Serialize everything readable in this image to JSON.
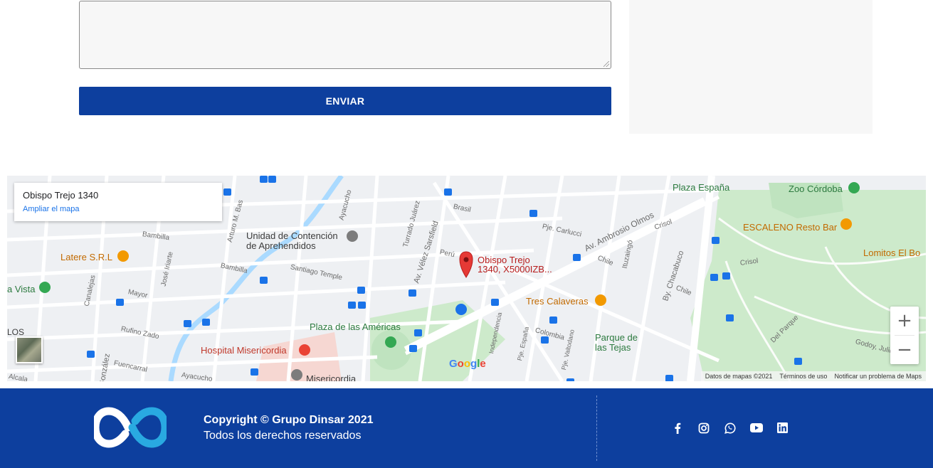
{
  "form": {
    "message_value": "",
    "send_label": "ENVIAR"
  },
  "map": {
    "info_card": {
      "title": "Obispo Trejo 1340",
      "link": "Ampliar el mapa"
    },
    "pin_label_line1": "Obispo Trejo",
    "pin_label_line2": "1340, X5000IZB...",
    "labels": {
      "plaza_espana": "Plaza España",
      "zoo_cordoba": "Zoo Córdoba",
      "escaleno": "ESCALENO Resto Bar",
      "lomitos": "Lomitos El Bo",
      "unidad_1": "Unidad de Contención",
      "unidad_2": "de Aprehendidos",
      "latere": "Latere S.R.L",
      "vista": "a Vista",
      "tres_calaveras": "Tres Calaveras",
      "parque_1": "Parque de",
      "parque_2": "las Tejas",
      "plaza_americas": "Plaza de las Américas",
      "hospital": "Hospital Misericordia",
      "misericordia": "Misericordia",
      "los": "LOS",
      "av_ambrosio": "Av. Ambrosio Olmos",
      "av_velez": "Av. Vélez Sarsfield",
      "by_chacabuco": "By. Chacabuco",
      "santiago_temple": "Santiago Temple",
      "bambilla_1": "Bambilla",
      "bambilla_2": "Bambilla",
      "arturo": "Arturo M. Bas",
      "ayacucho_1": "Ayacucho",
      "ayacucho_2": "Ayacucho",
      "turrado": "Turrado Juárez",
      "peru": "Perú",
      "brasil": "Brasil",
      "carlucci": "Pje. Carlucci",
      "chile_1": "Chile",
      "chile_2": "Chile",
      "crisol_1": "Crisol",
      "crisol_2": "Crisol",
      "ituzaingo": "Ituzaingó",
      "mayor": "Mayor",
      "rufino": "Rufino Zado",
      "fuencarral": "Fuencarral",
      "independencia": "Independencia",
      "espana": "Pje. España",
      "colombia": "Colombia",
      "valtodano": "Pje. Valtodano",
      "del_parque": "Del Parque",
      "godoy": "Godoy, Julio",
      "jose_inarte": "José Iriarte",
      "canalejas": "Canalejas",
      "gonzalez": "González",
      "alcala": "Alcala"
    },
    "google": "Google",
    "footer_data": "Datos de mapas ©2021",
    "footer_terms": "Términos de uso",
    "footer_report": "Notificar un problema de Maps"
  },
  "footer": {
    "copyright": "Copyright © Grupo Dinsar 2021",
    "rights": "Todos los derechos reservados",
    "social": [
      "facebook",
      "instagram",
      "whatsapp",
      "youtube",
      "linkedin"
    ]
  },
  "colors": {
    "brand_blue": "#0d3f9e",
    "logo_light_blue": "#29a9e1",
    "pin_red": "#e53935"
  }
}
